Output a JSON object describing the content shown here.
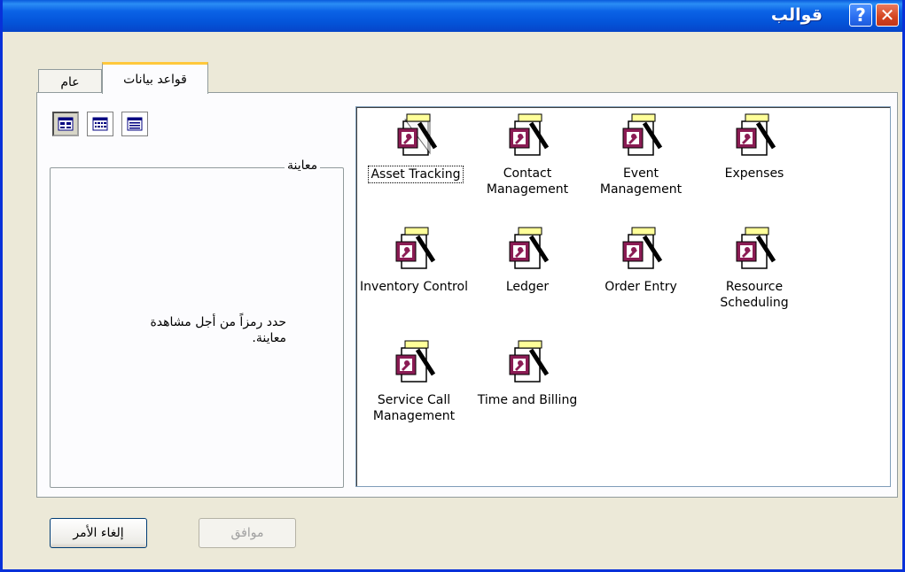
{
  "window": {
    "title": "قوالب",
    "help_glyph": "?",
    "close_glyph": "✕"
  },
  "tabs": [
    {
      "label": "قواعد بيانات",
      "active": true
    },
    {
      "label": "عام",
      "active": false
    }
  ],
  "view_buttons": [
    "large-icons",
    "list",
    "details"
  ],
  "preview": {
    "legend": "معاينة",
    "text": "حدد رمزاً من أجل مشاهدة معاينة."
  },
  "templates": [
    {
      "label": "Asset Tracking",
      "focused": true
    },
    {
      "label": "Contact Management"
    },
    {
      "label": "Event Management"
    },
    {
      "label": "Expenses"
    },
    {
      "label": "Inventory Control"
    },
    {
      "label": "Ledger"
    },
    {
      "label": "Order Entry"
    },
    {
      "label": "Resource Scheduling"
    },
    {
      "label": "Service Call Management"
    },
    {
      "label": "Time and Billing"
    }
  ],
  "buttons": {
    "cancel": "إلغاء الأمر",
    "ok": "موافق"
  },
  "colors": {
    "titlebar": "#0454d9",
    "dialog_bg": "#ece9d8",
    "icon_maroon": "#8b1c54"
  }
}
